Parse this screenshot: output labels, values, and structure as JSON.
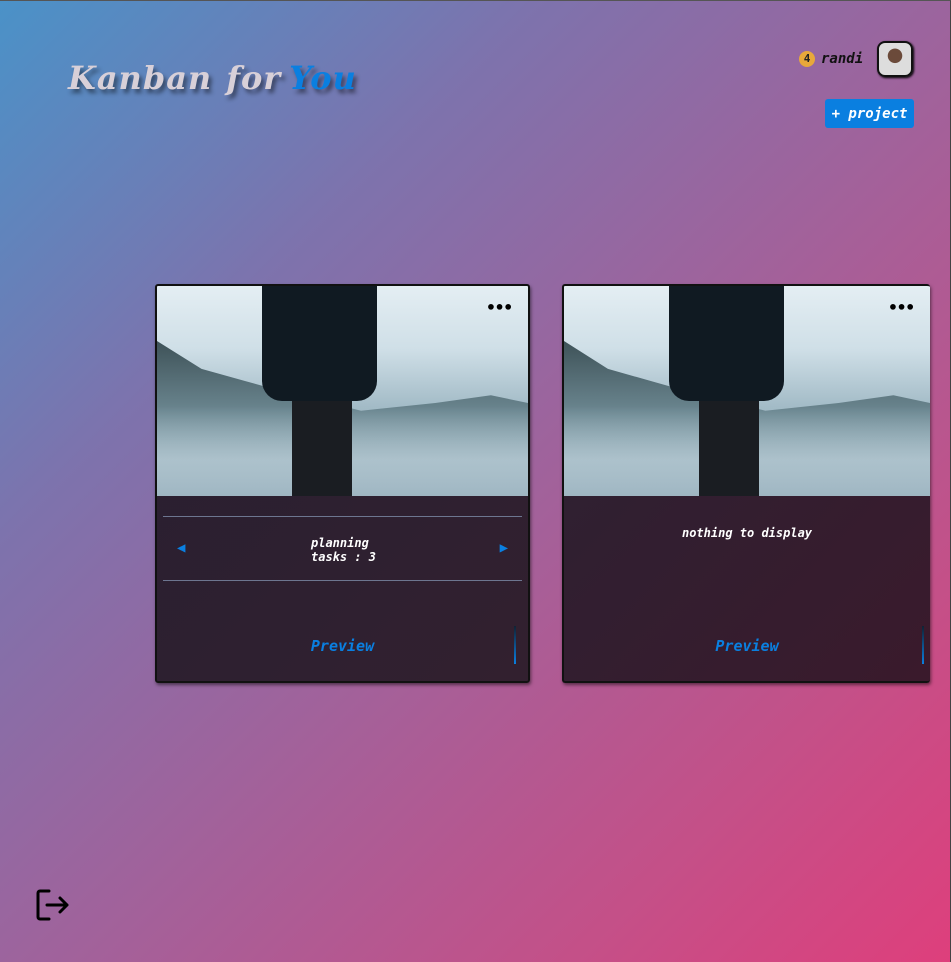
{
  "header": {
    "title_part1": "Kanban",
    "title_part2": "for",
    "title_part3": "You"
  },
  "user": {
    "notifications": "4",
    "name": "randi"
  },
  "actions": {
    "add_project": "+ project"
  },
  "projects": [
    {
      "stage": "planning",
      "tasks": "tasks : 3",
      "preview": "Preview",
      "menu": "•••"
    },
    {
      "empty": "nothing to display",
      "preview": "Preview",
      "menu": "•••"
    }
  ],
  "colors": {
    "accent": "#0a7fe0",
    "badge": "#e8a83a"
  }
}
